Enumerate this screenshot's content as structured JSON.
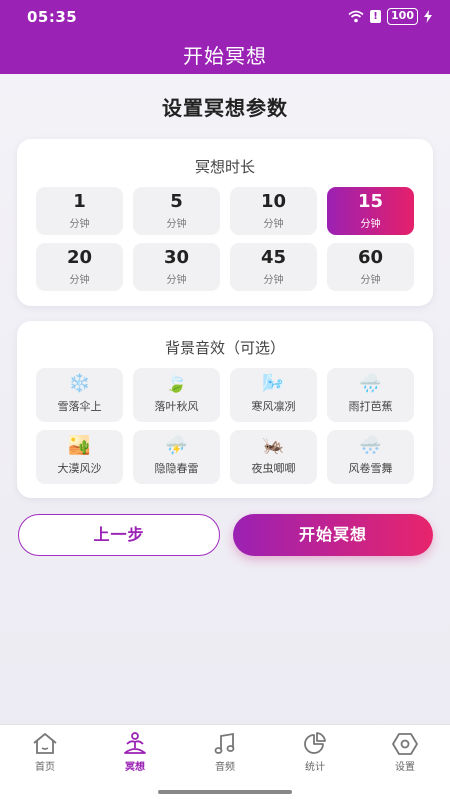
{
  "status_bar": {
    "time": "05:35",
    "battery": "100"
  },
  "header": {
    "title": "开始冥想"
  },
  "page_heading": "设置冥想参数",
  "duration": {
    "title": "冥想时长",
    "options": [
      {
        "value": "1",
        "unit": "分钟",
        "selected": false
      },
      {
        "value": "5",
        "unit": "分钟",
        "selected": false
      },
      {
        "value": "10",
        "unit": "分钟",
        "selected": false
      },
      {
        "value": "15",
        "unit": "分钟",
        "selected": true
      },
      {
        "value": "20",
        "unit": "分钟",
        "selected": false
      },
      {
        "value": "30",
        "unit": "分钟",
        "selected": false
      },
      {
        "value": "45",
        "unit": "分钟",
        "selected": false
      },
      {
        "value": "60",
        "unit": "分钟",
        "selected": false
      }
    ]
  },
  "sounds": {
    "title": "背景音效（可选）",
    "items": [
      {
        "icon": "snowflake-icon",
        "glyph": "❄️",
        "label": "雪落伞上"
      },
      {
        "icon": "leaf-icon",
        "glyph": "🍃",
        "label": "落叶秋风"
      },
      {
        "icon": "wind-icon",
        "glyph": "🌬️",
        "label": "寒风凛冽"
      },
      {
        "icon": "rain-cloud-icon",
        "glyph": "🌧️",
        "label": "雨打芭蕉"
      },
      {
        "icon": "desert-icon",
        "glyph": "🏜️",
        "label": "大漠风沙"
      },
      {
        "icon": "thunder-cloud-icon",
        "glyph": "⛈️",
        "label": "隐隐春雷"
      },
      {
        "icon": "cricket-icon",
        "glyph": "🦗",
        "label": "夜虫唧唧"
      },
      {
        "icon": "snow-cloud-icon",
        "glyph": "🌨️",
        "label": "风卷雪舞"
      }
    ]
  },
  "actions": {
    "back_label": "上一步",
    "start_label": "开始冥想"
  },
  "nav": {
    "items": [
      {
        "icon": "home-icon",
        "label": "首页",
        "active": false
      },
      {
        "icon": "meditation-icon",
        "label": "冥想",
        "active": true
      },
      {
        "icon": "music-icon",
        "label": "音频",
        "active": false
      },
      {
        "icon": "pie-chart-icon",
        "label": "统计",
        "active": false
      },
      {
        "icon": "hexagon-settings-icon",
        "label": "设置",
        "active": false
      }
    ]
  },
  "colors": {
    "primary": "#9a22b4",
    "gradient_end": "#e5206a",
    "tile_bg": "#f1f1f3"
  }
}
